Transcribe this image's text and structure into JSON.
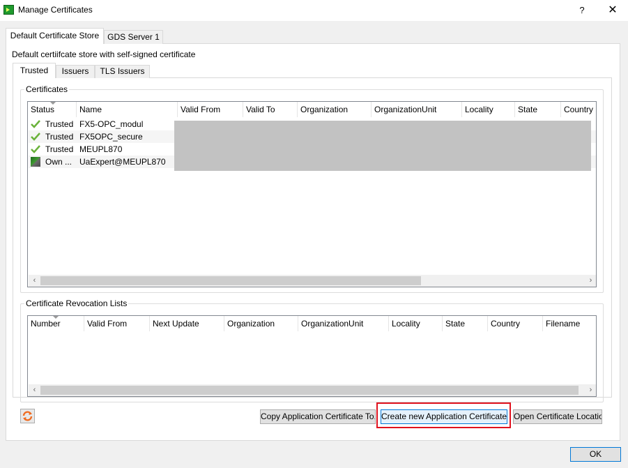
{
  "window": {
    "title": "Manage Certificates",
    "help_glyph": "?",
    "close_glyph": "✕",
    "icon": "app-icon"
  },
  "outer_tabs": [
    {
      "label": "Default Certificate Store",
      "active": true
    },
    {
      "label": "GDS Server 1",
      "active": false
    }
  ],
  "store_description": "Default certiifcate store with self-signed certificate",
  "inner_tabs": [
    {
      "label": "Trusted",
      "active": true
    },
    {
      "label": "Issuers",
      "active": false
    },
    {
      "label": "TLS Issuers",
      "active": false
    }
  ],
  "certificates": {
    "group_title": "Certificates",
    "columns": [
      "Status",
      "Name",
      "Valid From",
      "Valid To",
      "Organization",
      "OrganizationUnit",
      "Locality",
      "State",
      "Country"
    ],
    "rows": [
      {
        "icon": "check-icon",
        "status": "Trusted",
        "name": "FX5-OPC_modul"
      },
      {
        "icon": "check-icon",
        "status": "Trusted",
        "name": "FX5OPC_secure"
      },
      {
        "icon": "check-icon",
        "status": "Trusted",
        "name": "MEUPL870"
      },
      {
        "icon": "own-certificate-icon",
        "status": "Own ...",
        "name": "UaExpert@MEUPL870"
      }
    ]
  },
  "crl": {
    "group_title": "Certificate Revocation Lists",
    "columns": [
      "Number",
      "Valid From",
      "Next Update",
      "Organization",
      "OrganizationUnit",
      "Locality",
      "State",
      "Country",
      "Filename"
    ],
    "rows": []
  },
  "scroll": {
    "left_glyph": "‹",
    "right_glyph": "›"
  },
  "buttons": {
    "refresh_icon": "refresh-icon",
    "copy": "Copy Application Certificate To...",
    "create": "Create new Application Certificate...",
    "open_location": "Open Certificate Location",
    "ok": "OK"
  },
  "colors": {
    "highlight": "#e0121e",
    "focus": "#0078d7",
    "app_icon": "#1f9a2e",
    "check": "#6ab23a",
    "refresh": "#f06a1e"
  }
}
